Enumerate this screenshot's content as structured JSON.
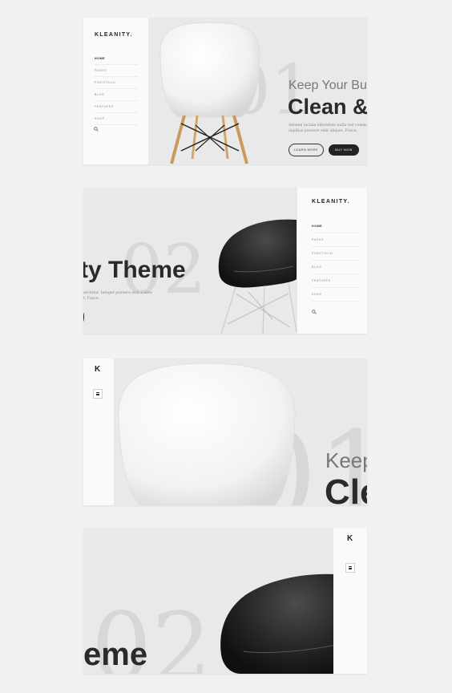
{
  "brand": {
    "logo": "KLEANITY.",
    "logo_short": "K"
  },
  "nav": [
    "HOME",
    "PAGES",
    "PORTFOLIO",
    "BLOG",
    "FEATURES",
    "SHOP"
  ],
  "slides": {
    "one": {
      "number": "01",
      "subtitle": "Keep Your Bus",
      "title": "Clean &",
      "description": "Aenean lacinia bibendum nulla sed consecte dapibus posuere velit aliquet. Fusce.",
      "btn_learn": "LEARN MORE",
      "btn_buy": "BUY NOW"
    },
    "two": {
      "number": "02",
      "title": "ty Theme",
      "description_line1": "sectetur. Integer posuere erat a ante",
      "description_line2": "t. Fusce.",
      "stray_glyph": ")"
    },
    "three": {
      "number": "01",
      "subtitle": "Keep",
      "title": "Cle"
    },
    "four": {
      "number": "02",
      "title": "eme"
    }
  },
  "icons": {
    "search": "search-icon",
    "menu": "hamburger-icon"
  },
  "colors": {
    "background": "#f1f1f1",
    "panel": "#e9e9e9",
    "sidebar": "#fafafa",
    "dark": "#222222"
  }
}
